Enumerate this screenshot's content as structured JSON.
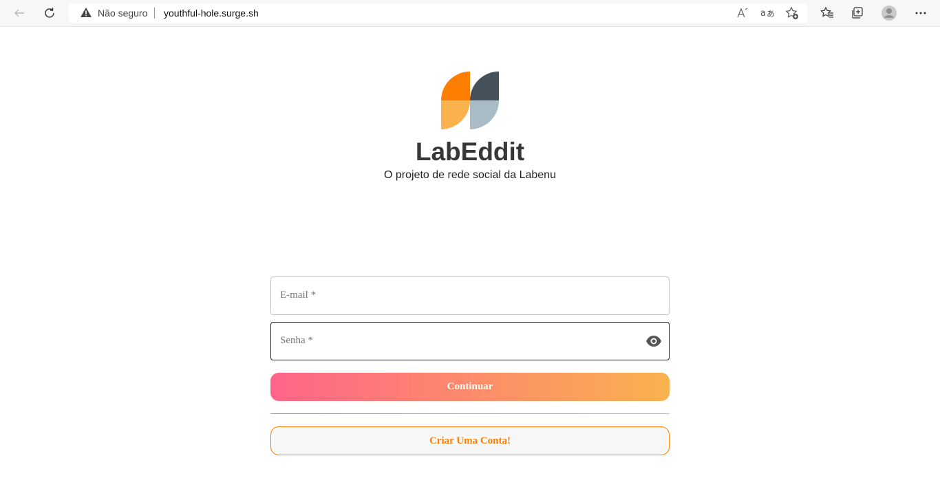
{
  "browser": {
    "security_label": "Não seguro",
    "url": "youthful-hole.surge.sh",
    "icons": [
      "back-icon",
      "refresh-icon",
      "warning-icon",
      "read-aloud-icon",
      "translate-icon",
      "add-favorite-icon",
      "favorites-icon",
      "collections-icon",
      "profile-icon",
      "more-icon"
    ]
  },
  "brand": {
    "name": "LabEddit",
    "tagline": "O projeto de rede social da Labenu",
    "colors": {
      "orange": "#fe7e02",
      "light_orange": "#f9b24e",
      "dark_gray": "#45525b",
      "light_gray": "#a8bbc6"
    }
  },
  "form": {
    "email_label": "E-mail *",
    "password_label": "Senha *",
    "continue_label": "Continuar",
    "create_account_label": "Criar Uma Conta!"
  },
  "colors": {
    "gradient_start": "#ff6489",
    "gradient_end": "#f9b24e",
    "accent": "#fe7e02"
  }
}
